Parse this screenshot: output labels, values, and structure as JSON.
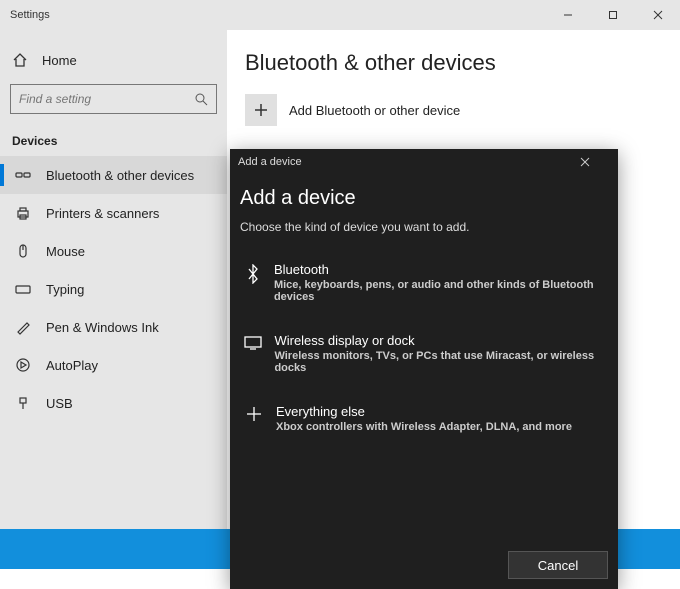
{
  "window": {
    "title": "Settings"
  },
  "home_label": "Home",
  "search_placeholder": "Find a setting",
  "section": "Devices",
  "nav": [
    {
      "label": "Bluetooth & other devices"
    },
    {
      "label": "Printers & scanners"
    },
    {
      "label": "Mouse"
    },
    {
      "label": "Typing"
    },
    {
      "label": "Pen & Windows Ink"
    },
    {
      "label": "AutoPlay"
    },
    {
      "label": "USB"
    }
  ],
  "page": {
    "title": "Bluetooth & other devices",
    "add_label": "Add Bluetooth or other device"
  },
  "dialog": {
    "titlebar": "Add a device",
    "header": "Add a device",
    "subtitle": "Choose the kind of device you want to add.",
    "options": [
      {
        "title": "Bluetooth",
        "desc": "Mice, keyboards, pens, or audio and other kinds of Bluetooth devices"
      },
      {
        "title": "Wireless display or dock",
        "desc": "Wireless monitors, TVs, or PCs that use Miracast, or wireless docks"
      },
      {
        "title": "Everything else",
        "desc": "Xbox controllers with Wireless Adapter, DLNA, and more"
      }
    ],
    "cancel": "Cancel"
  }
}
